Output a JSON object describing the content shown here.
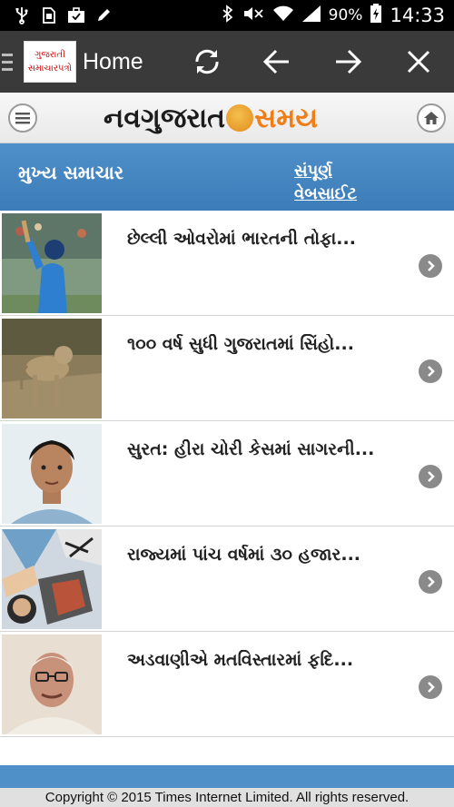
{
  "status_bar": {
    "icons": [
      "usb-icon",
      "sim-icon",
      "briefcase-icon",
      "pencil-icon",
      "bluetooth-icon",
      "mute-icon",
      "wifi-icon",
      "signal-icon",
      "battery-icon"
    ],
    "battery": "90%",
    "time": "14:33"
  },
  "toolbar": {
    "logo_line1": "ગુજરાતી",
    "logo_line2": "સમાચારપત્રો",
    "title": "Home",
    "icons": [
      "refresh-icon",
      "back-arrow-icon",
      "forward-arrow-icon",
      "close-icon"
    ]
  },
  "brand": {
    "name_part1": "નવગુજરાત",
    "name_part2": "સમય",
    "brand_color": "#f07d16",
    "icons": [
      "menu-icon",
      "home-icon"
    ]
  },
  "section": {
    "title": "મુખ્ય સમાચાર",
    "full_site_line1": "સંપૂર્ણ",
    "full_site_line2": "વેબસાઈટ",
    "bar_color": "#4a8ac6"
  },
  "news": [
    {
      "headline": "છેલ્લી ઓવરોમાં ભારતની તોફા...",
      "thumb": "cricket-player-image"
    },
    {
      "headline": "૧૦૦ વર્ષ સુધી ગુજરાતમાં સિંહો...",
      "thumb": "lion-image"
    },
    {
      "headline": "સુરત: હીરા ચોરી કેસમાં સાગરની...",
      "thumb": "young-man-portrait-image"
    },
    {
      "headline": "રાજ્યમાં પાંચ વર્ષમાં ૩૦ હજાર...",
      "thumb": "illustration-collage-image"
    },
    {
      "headline": "અડવાણીએ મતવિસ્તારમાં ફદિ...",
      "thumb": "elderly-politician-portrait-image"
    }
  ],
  "footer": {
    "copyright": "Copyright © 2015 Times Internet Limited. All rights reserved."
  }
}
